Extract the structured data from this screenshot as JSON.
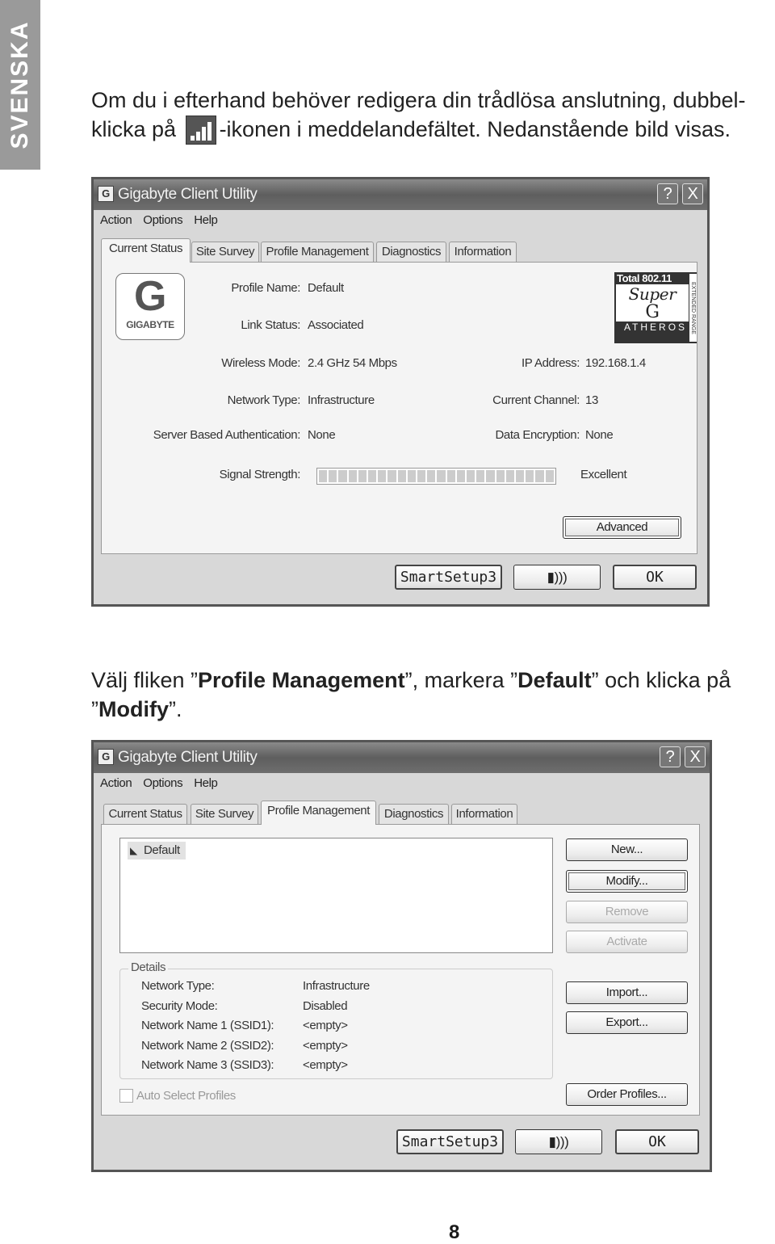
{
  "side_tab": "SVENSKA",
  "para1": {
    "before": "Om du i efterhand behöver redigera din trådlösa anslutning, dubbel-klicka på",
    "icon": "signal-bars-icon",
    "after": "-ikonen i meddelandefältet. Nedanstående bild visas."
  },
  "para2": {
    "t1": "Välj fliken ”",
    "b1": "Profile Management",
    "t2": "”, markera ”",
    "b2": "Default",
    "t3": "” och klicka på ”",
    "b3": "Modify",
    "t4": "”."
  },
  "page_number": "8",
  "window": {
    "title": "Gigabyte Client Utility",
    "help": "?",
    "close": "X",
    "menu": [
      "Action",
      "Options",
      "Help"
    ],
    "tabs": [
      "Current Status",
      "Site Survey",
      "Profile Management",
      "Diagnostics",
      "Information"
    ],
    "bottom": {
      "smartsetup": "SmartSetup3",
      "wireless_icon": "wireless-card-icon",
      "ok": "OK"
    }
  },
  "status": {
    "logo": "GIGABYTE",
    "badge": {
      "line1": "Total 802.11",
      "line2": "Super",
      "line3": "G",
      "line4": "ATHEROS",
      "side": "EXTENDED RANGE"
    },
    "left": [
      {
        "label": "Profile Name:",
        "value": "Default"
      },
      {
        "label": "Link Status:",
        "value": "Associated"
      },
      {
        "label": "Wireless Mode:",
        "value": "2.4 GHz 54 Mbps"
      },
      {
        "label": "Network Type:",
        "value": "Infrastructure"
      },
      {
        "label": "Server Based Authentication:",
        "value": "None"
      }
    ],
    "right": [
      {
        "label": "IP Address:",
        "value": "192.168.1.4"
      },
      {
        "label": "Current Channel:",
        "value": "13"
      },
      {
        "label": "Data Encryption:",
        "value": "None"
      }
    ],
    "signal": {
      "label": "Signal Strength:",
      "value": "Excellent",
      "level_percent": 100
    },
    "advanced": "Advanced"
  },
  "profiles": {
    "list": [
      "Default"
    ],
    "buttons": {
      "new": "New...",
      "modify": "Modify...",
      "remove": "Remove",
      "activate": "Activate",
      "import": "Import...",
      "export": "Export...",
      "order": "Order Profiles..."
    },
    "details_title": "Details",
    "details": [
      {
        "label": "Network Type:",
        "value": "Infrastructure"
      },
      {
        "label": "Security Mode:",
        "value": "Disabled"
      },
      {
        "label": "Network Name 1 (SSID1):",
        "value": "<empty>"
      },
      {
        "label": "Network Name 2 (SSID2):",
        "value": "<empty>"
      },
      {
        "label": "Network Name 3 (SSID3):",
        "value": "<empty>"
      }
    ],
    "auto_select": "Auto Select Profiles",
    "auto_select_checked": false
  }
}
